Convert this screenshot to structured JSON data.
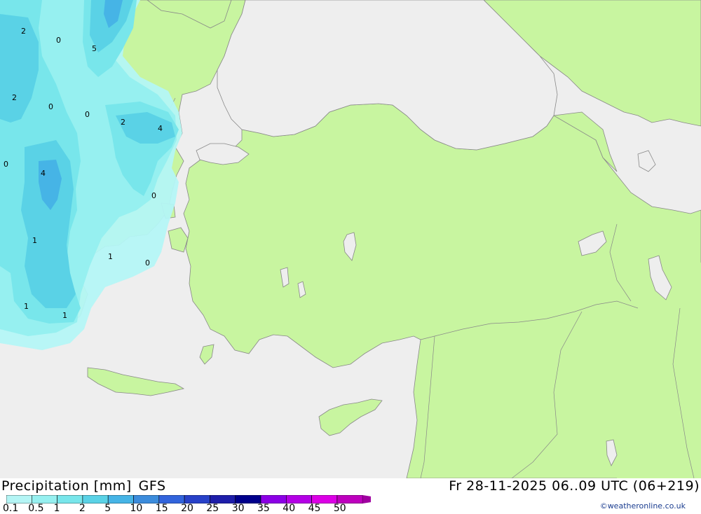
{
  "header": {
    "product": "Precipitation [mm]",
    "model": "GFS",
    "valid_time": "Fr 28-11-2025 06..09 UTC (06+219)"
  },
  "legend": {
    "labels": [
      "0.1",
      "0.5",
      "1",
      "2",
      "5",
      "10",
      "15",
      "20",
      "25",
      "30",
      "35",
      "40",
      "45",
      "50"
    ],
    "colors": [
      "#b4f5f5",
      "#96f0f0",
      "#78e6eb",
      "#5ad2e6",
      "#46b4e6",
      "#3c8cdc",
      "#3264dc",
      "#2841c8",
      "#1e1eaa",
      "#00008c",
      "#8c00e6",
      "#b400e6",
      "#dc00e6",
      "#be00be",
      "#a000a0"
    ]
  },
  "contour_labels": [
    {
      "text": "2"
    },
    {
      "text": "0"
    },
    {
      "text": "5"
    },
    {
      "text": "2"
    },
    {
      "text": "0"
    },
    {
      "text": "0"
    },
    {
      "text": "2"
    },
    {
      "text": "4"
    },
    {
      "text": "0"
    },
    {
      "text": "4"
    },
    {
      "text": "0"
    },
    {
      "text": "1"
    },
    {
      "text": "1"
    },
    {
      "text": "0"
    },
    {
      "text": "1"
    },
    {
      "text": "1"
    }
  ],
  "credit": "©weatheronline.co.uk",
  "colors": {
    "sea": "#eeeeee",
    "land": "#c8f5a0",
    "border": "#888888"
  }
}
